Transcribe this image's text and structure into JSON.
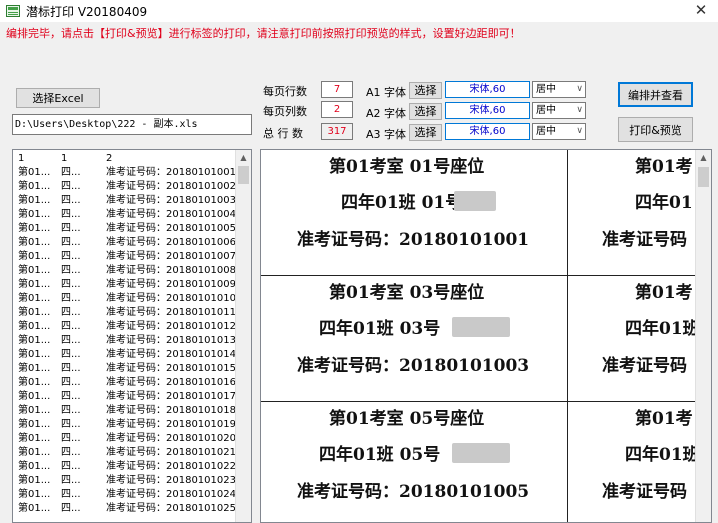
{
  "window": {
    "title": "潜标打印 V20180409",
    "close_glyph": "✕"
  },
  "notice": "编排完毕，请点击【打印&预览】进行标签的打印，请注意打印前按照打印预览的样式，设置好边距即可！",
  "select_excel_label": "选择Excel",
  "file_path": "D:\\Users\\Desktop\\222 - 副本.xls",
  "settings": {
    "rows_per_page_label": "每页行数",
    "rows_per_page": "7",
    "cols_per_page_label": "每页列数",
    "cols_per_page": "2",
    "total_rows_label": "总 行 数",
    "total_rows": "317"
  },
  "fonts": [
    {
      "label": "A1 字体",
      "select_label": "选择",
      "font": "宋体,60",
      "align": "居中"
    },
    {
      "label": "A2 字体",
      "select_label": "选择",
      "font": "宋体,60",
      "align": "居中"
    },
    {
      "label": "A3 字体",
      "select_label": "选择",
      "font": "宋体,60",
      "align": "居中"
    }
  ],
  "arrange_button": "编排并查看",
  "print_button": "打印&预览",
  "list": {
    "header": [
      "1",
      "1",
      "2"
    ],
    "rows": [
      {
        "c1": "第01...",
        "c2": "四...",
        "c3": "准考证号码：20180101001"
      },
      {
        "c1": "第01...",
        "c2": "四...",
        "c3": "准考证号码：20180101002"
      },
      {
        "c1": "第01...",
        "c2": "四...",
        "c3": "准考证号码：20180101003"
      },
      {
        "c1": "第01...",
        "c2": "四...",
        "c3": "准考证号码：20180101004"
      },
      {
        "c1": "第01...",
        "c2": "四...",
        "c3": "准考证号码：20180101005"
      },
      {
        "c1": "第01...",
        "c2": "四...",
        "c3": "准考证号码：20180101006"
      },
      {
        "c1": "第01...",
        "c2": "四...",
        "c3": "准考证号码：20180101007"
      },
      {
        "c1": "第01...",
        "c2": "四...",
        "c3": "准考证号码：20180101008"
      },
      {
        "c1": "第01...",
        "c2": "四...",
        "c3": "准考证号码：20180101009"
      },
      {
        "c1": "第01...",
        "c2": "四...",
        "c3": "准考证号码：20180101010"
      },
      {
        "c1": "第01...",
        "c2": "四...",
        "c3": "准考证号码：20180101011"
      },
      {
        "c1": "第01...",
        "c2": "四...",
        "c3": "准考证号码：20180101012"
      },
      {
        "c1": "第01...",
        "c2": "四...",
        "c3": "准考证号码：20180101013"
      },
      {
        "c1": "第01...",
        "c2": "四...",
        "c3": "准考证号码：20180101014"
      },
      {
        "c1": "第01...",
        "c2": "四...",
        "c3": "准考证号码：20180101015"
      },
      {
        "c1": "第01...",
        "c2": "四...",
        "c3": "准考证号码：20180101016"
      },
      {
        "c1": "第01...",
        "c2": "四...",
        "c3": "准考证号码：20180101017"
      },
      {
        "c1": "第01...",
        "c2": "四...",
        "c3": "准考证号码：20180101018"
      },
      {
        "c1": "第01...",
        "c2": "四...",
        "c3": "准考证号码：20180101019"
      },
      {
        "c1": "第01...",
        "c2": "四...",
        "c3": "准考证号码：20180101020"
      },
      {
        "c1": "第01...",
        "c2": "四...",
        "c3": "准考证号码：20180101021"
      },
      {
        "c1": "第01...",
        "c2": "四...",
        "c3": "准考证号码：20180101022"
      },
      {
        "c1": "第01...",
        "c2": "四...",
        "c3": "准考证号码：20180101023"
      },
      {
        "c1": "第01...",
        "c2": "四...",
        "c3": "准考证号码：20180101024"
      },
      {
        "c1": "第01...",
        "c2": "四...",
        "c3": "准考证号码：20180101025"
      }
    ]
  },
  "preview": {
    "labels": [
      {
        "line1": "第01考室  01号座位",
        "line2": "四年01班  01号",
        "line3": "准考证号码：20180101001"
      },
      {
        "line1": "第01考",
        "line2": "四年01",
        "line3": "准考证号码"
      },
      {
        "line1": "第01考室  03号座位",
        "line2": "四年01班  03号",
        "line3": "准考证号码：20180101003"
      },
      {
        "line1": "第01考",
        "line2": "四年01班",
        "line3": "准考证号码"
      },
      {
        "line1": "第01考室  05号座位",
        "line2": "四年01班  05号",
        "line3": "准考证号码：20180101005"
      },
      {
        "line1": "第01考",
        "line2": "四年01班",
        "line3": "准考证号码"
      }
    ]
  }
}
